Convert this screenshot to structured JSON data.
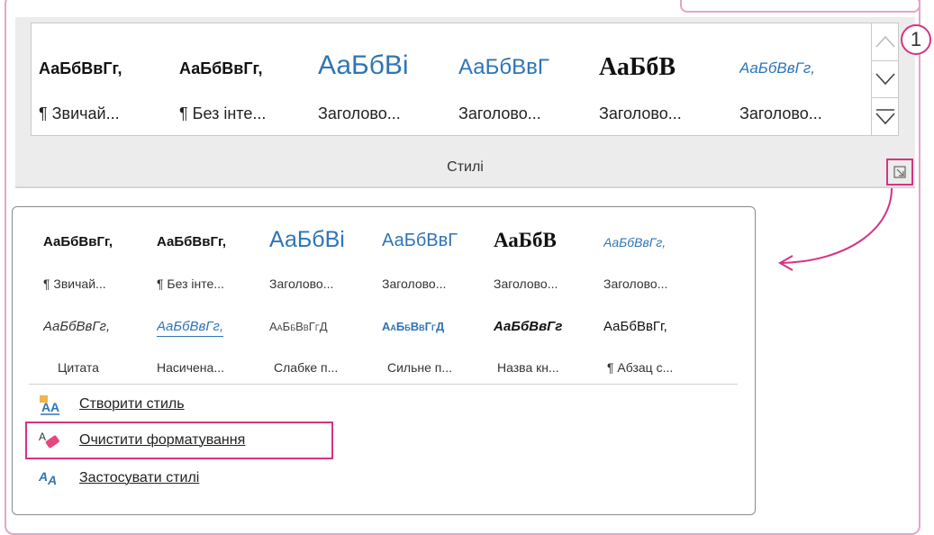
{
  "ribbon": {
    "group_label": "Стилі",
    "styles": [
      {
        "sample": "АаБбВвГг,",
        "name": "¶ Звичай...",
        "color": "#111111"
      },
      {
        "sample": "АаБбВвГг,",
        "name": "¶ Без інте...",
        "color": "#111111"
      },
      {
        "sample": "АаБбВі",
        "name": "Заголово...",
        "color": "#2e75b6"
      },
      {
        "sample": "АаБбВвГ",
        "name": "Заголово...",
        "color": "#2e75b6"
      },
      {
        "sample": "АаБбВ",
        "name": "Заголово...",
        "color": "#111111"
      },
      {
        "sample": "АаБбВвГг,",
        "name": "Заголово...",
        "color": "#2e75b6"
      }
    ]
  },
  "callout_number": "1",
  "panel": {
    "row1": [
      {
        "sample": "АаБбВвГг,",
        "name": "¶ Звичай..."
      },
      {
        "sample": "АаБбВвГг,",
        "name": "¶ Без інте..."
      },
      {
        "sample": "АаБбВі",
        "name": "Заголово..."
      },
      {
        "sample": "АаБбВвГ",
        "name": "Заголово..."
      },
      {
        "sample": "АаБбВ",
        "name": "Заголово..."
      },
      {
        "sample": "АаБбВвГг,",
        "name": "Заголово..."
      }
    ],
    "row2": [
      {
        "sample": "АаБбВвГг,",
        "name": "Цитата"
      },
      {
        "sample": "АаБбВвГг,",
        "name": "Насичена..."
      },
      {
        "sample": "АаБбВвГгД",
        "name": "Слабке п..."
      },
      {
        "sample": "АаБбВвГгД",
        "name": "Сильне п..."
      },
      {
        "sample": "АаБбВвГг",
        "name": "Назва кн..."
      },
      {
        "sample": "АаБбВвГг,",
        "name": "¶ Абзац с..."
      }
    ],
    "commands": [
      {
        "label": "Створити стиль",
        "icon": "new-style-icon"
      },
      {
        "label": "Очистити форматування",
        "icon": "clear-formatting-icon"
      },
      {
        "label": "Застосувати стилі",
        "icon": "apply-styles-icon"
      }
    ]
  },
  "colors": {
    "accent_pink": "#d63384",
    "heading_blue": "#2e75b6"
  }
}
